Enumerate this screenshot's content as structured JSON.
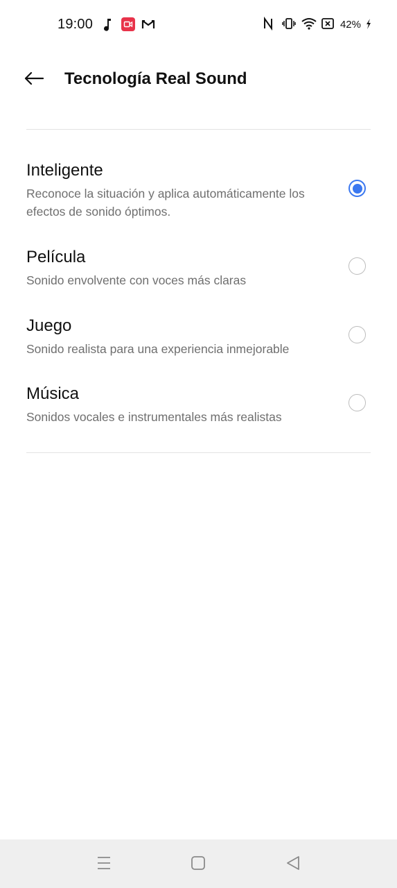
{
  "status_bar": {
    "time": "19:00",
    "battery": "42%",
    "left_icons": [
      "music-note-icon",
      "screen-record-icon",
      "gmail-icon"
    ],
    "right_icons": [
      "nfc-icon",
      "vibrate-icon",
      "wifi-icon",
      "no-sim-icon",
      "battery-charging-icon"
    ],
    "record_icon_color": "#e8334a"
  },
  "header": {
    "title": "Tecnología Real Sound",
    "back_icon": "arrow-left-icon"
  },
  "options": [
    {
      "title": "Inteligente",
      "description": "Reconoce la situación y aplica automáticamente los efectos de sonido óptimos.",
      "selected": true
    },
    {
      "title": "Película",
      "description": "Sonido envolvente con voces más claras",
      "selected": false
    },
    {
      "title": "Juego",
      "description": "Sonido realista para una experiencia inmejorable",
      "selected": false
    },
    {
      "title": "Música",
      "description": "Sonidos vocales e instrumentales más realistas",
      "selected": false
    }
  ],
  "colors": {
    "accent": "#3b78f0",
    "secondary_text": "#6f6f6f",
    "divider": "#e3e3e3",
    "nav_bar_bg": "#efefef"
  },
  "nav_bar": {
    "buttons": [
      "menu-icon",
      "home-icon",
      "back-triangle-icon"
    ]
  }
}
